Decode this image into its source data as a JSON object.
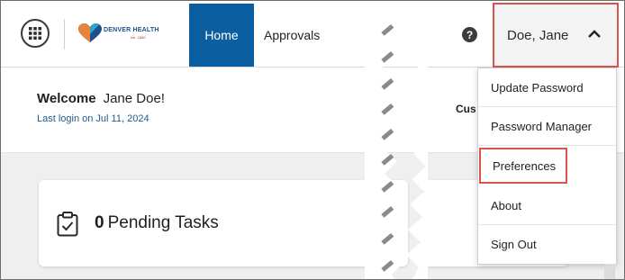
{
  "header": {
    "apps_icon": "grid-icon",
    "logo_text": "DENVER HEALTH",
    "logo_sub": "est. 1860",
    "tabs": [
      {
        "label": "Home",
        "active": true
      },
      {
        "label": "Approvals",
        "active": false
      }
    ],
    "help_icon": "question-circle-icon",
    "user_name": "Doe, Jane",
    "user_menu_icon": "chevron-up-icon"
  },
  "welcome": {
    "heading": "Welcome",
    "name": "Jane Doe!",
    "last_login": "Last login on Jul 11, 2024",
    "partial_label": "Cus"
  },
  "tasks": {
    "count": "0",
    "label": "Pending Tasks",
    "icon": "clipboard-check-icon"
  },
  "user_menu": {
    "items": [
      {
        "label": "Update Password"
      },
      {
        "label": "Password Manager"
      },
      {
        "label": "Preferences",
        "highlighted": true
      },
      {
        "label": "About"
      },
      {
        "label": "Sign Out"
      }
    ]
  },
  "colors": {
    "active_tab": "#0b5fa0",
    "highlight_border": "#d9534f",
    "link_blue": "#1b5a8f"
  }
}
